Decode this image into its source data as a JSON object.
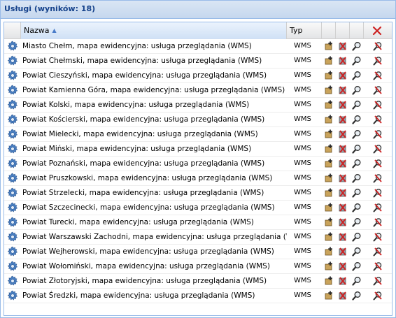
{
  "panel": {
    "title": "Usługi (wyników: 18)"
  },
  "grid": {
    "columns": {
      "name": "Nazwa",
      "type": "Typ"
    },
    "sort": {
      "column": "name",
      "direction": "ascending"
    },
    "header_icons": [
      "delete-all-icon"
    ],
    "row_icons": [
      "service-gear-icon",
      "add-layer-icon",
      "remove-icon",
      "zoom-icon",
      "delete-icon"
    ],
    "rows": [
      {
        "name": "Miasto Chełm, mapa ewidencyjna: usługa przeglądania (WMS)",
        "type": "WMS"
      },
      {
        "name": "Powiat Chełmski, mapa ewidencyjna: usługa przeglądania (WMS)",
        "type": "WMS"
      },
      {
        "name": "Powiat Cieszyński, mapa ewidencyjna: usługa przeglądania (WMS)",
        "type": "WMS"
      },
      {
        "name": "Powiat Kamienna Góra, mapa ewidencyjna: usługa przeglądania (WMS)",
        "type": "WMS"
      },
      {
        "name": "Powiat Kolski, mapa ewidencyjna: usługa przeglądania (WMS)",
        "type": "WMS"
      },
      {
        "name": "Powiat Kościerski, mapa ewidencyjna: usługa przeglądania (WMS)",
        "type": "WMS"
      },
      {
        "name": "Powiat Mielecki, mapa ewidencyjna: usługa przeglądania (WMS)",
        "type": "WMS"
      },
      {
        "name": "Powiat Miński, mapa ewidencyjna: usługa przeglądania (WMS)",
        "type": "WMS"
      },
      {
        "name": "Powiat Poznański, mapa ewidencyjna: usługa przeglądania (WMS)",
        "type": "WMS"
      },
      {
        "name": "Powiat Pruszkowski, mapa ewidencyjna: usługa przeglądania (WMS)",
        "type": "WMS"
      },
      {
        "name": "Powiat Strzelecki, mapa ewidencyjna: usługa przeglądania (WMS)",
        "type": "WMS"
      },
      {
        "name": "Powiat Szczecinecki, mapa ewidencyjna: usługa przeglądania (WMS)",
        "type": "WMS"
      },
      {
        "name": "Powiat Turecki, mapa ewidencyjna: usługa przeglądania (WMS)",
        "type": "WMS"
      },
      {
        "name": "Powiat Warszawski Zachodni, mapa ewidencyjna: usługa przeglądania (WMS)",
        "type": "WMS"
      },
      {
        "name": "Powiat Wejherowski, mapa ewidencyjna: usługa przeglądania (WMS)",
        "type": "WMS"
      },
      {
        "name": "Powiat Wołomiński, mapa ewidencyjna: usługa przeglądania (WMS)",
        "type": "WMS"
      },
      {
        "name": "Powiat Złotoryjski, mapa ewidencyjna: usługa przeglądania (WMS)",
        "type": "WMS"
      },
      {
        "name": "Powiat Średzki, mapa ewidencyjna: usługa przeglądania (WMS)",
        "type": "WMS"
      }
    ]
  },
  "colors": {
    "header_text": "#15428b",
    "panel_border": "#99bbe8",
    "delete_red": "#cc2222"
  }
}
